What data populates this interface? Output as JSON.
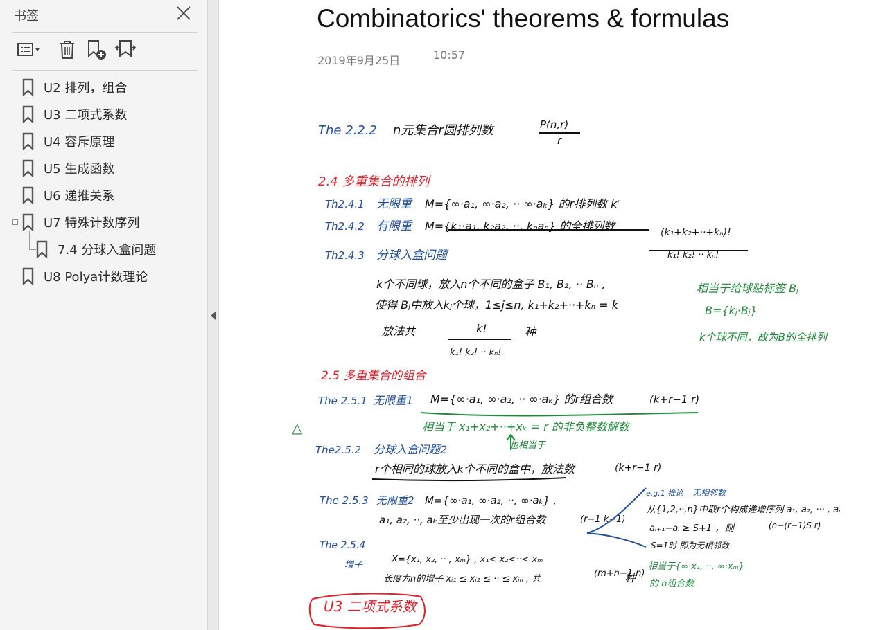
{
  "sidebar": {
    "title": "书签",
    "toolbar": {
      "options_icon": "list-options-icon",
      "delete_icon": "trash-icon",
      "add_icon": "bookmark-add-icon",
      "find_icon": "bookmark-find-icon"
    },
    "items": [
      {
        "label": "U2 排列，组合"
      },
      {
        "label": "U3 二项式系数"
      },
      {
        "label": "U4 容斥原理"
      },
      {
        "label": "U5 生成函数"
      },
      {
        "label": "U6 递推关系"
      },
      {
        "label": "U7 特殊计数序列"
      },
      {
        "label": "7.4 分球入盒问题"
      },
      {
        "label": "U8 Polya计数理论"
      }
    ]
  },
  "document": {
    "title": "Combinatorics' theorems & formulas",
    "date": "2019年9月25日",
    "time": "10:57"
  },
  "notes": {
    "colors": {
      "blue": "#1f4f9c",
      "red": "#e0202a",
      "green": "#1f8a3a",
      "dark": "#111111"
    },
    "lines": [
      {
        "text": "The 2.2.2",
        "color": "blue"
      },
      {
        "text": "n元集合r圆排列数",
        "color": "dark"
      },
      {
        "text": "P(n,r)",
        "color": "dark"
      },
      {
        "text": "r",
        "color": "dark"
      },
      {
        "text": "2.4 多重集合的排列",
        "color": "red"
      },
      {
        "text": "Th2.4.1",
        "color": "blue"
      },
      {
        "text": "无限重",
        "color": "blue"
      },
      {
        "text": "M={∞·a₁, ∞·a₂, ·· ∞·aₖ} 的r排列数 kʳ",
        "color": "dark"
      },
      {
        "text": "Th2.4.2",
        "color": "blue"
      },
      {
        "text": "有限重",
        "color": "blue"
      },
      {
        "text": "M={k₁·a₁, k₂a₂, ··, kₙaₙ} 的全排列数",
        "color": "dark"
      },
      {
        "text": "(k₁+k₂+··+kₙ)!",
        "color": "dark"
      },
      {
        "text": "k₁! k₂! ·· kₙ!",
        "color": "dark"
      },
      {
        "text": "Th2.4.3",
        "color": "blue"
      },
      {
        "text": "分球入盒问题",
        "color": "blue"
      },
      {
        "text": "k个不同球，放入n个不同的盒子 B₁, B₂, ·· Bₙ ,",
        "color": "dark"
      },
      {
        "text": "使得 Bⱼ中放入kⱼ个球，1≤j≤n, k₁+k₂+··+kₙ = k",
        "color": "dark"
      },
      {
        "text": "放法共",
        "color": "dark"
      },
      {
        "text": "k!",
        "color": "dark"
      },
      {
        "text": "k₁! k₂! ·· kₙ!",
        "color": "dark"
      },
      {
        "text": "种",
        "color": "dark"
      },
      {
        "text": "相当于给球贴标签 Bⱼ",
        "color": "green"
      },
      {
        "text": "B={kⱼ·Bⱼ}",
        "color": "green"
      },
      {
        "text": "k个球不同，故为B的全排列",
        "color": "green"
      },
      {
        "text": "2.5 多重集合的组合",
        "color": "red"
      },
      {
        "text": "The 2.5.1",
        "color": "blue"
      },
      {
        "text": "无限重1",
        "color": "blue"
      },
      {
        "text": "M={∞·a₁, ∞·a₂, ·· ∞·aₖ} 的r组合数",
        "color": "dark"
      },
      {
        "text": "(k+r−1 r)",
        "color": "dark"
      },
      {
        "text": "相当于 x₁+x₂+··+xₖ = r 的非负整数解数",
        "color": "green"
      },
      {
        "text": "△",
        "color": "green"
      },
      {
        "text": "The2.5.2",
        "color": "blue"
      },
      {
        "text": "分球入盒问题2",
        "color": "blue"
      },
      {
        "text": "也相当于",
        "color": "green"
      },
      {
        "text": "r个相同的球放入k个不同的盒中，放法数",
        "color": "dark"
      },
      {
        "text": "(k+r−1 r)",
        "color": "dark"
      },
      {
        "text": "The 2.5.3",
        "color": "blue"
      },
      {
        "text": "无限重2",
        "color": "blue"
      },
      {
        "text": "M={∞·a₁, ∞·a₂, ··, ∞·aₖ} ,",
        "color": "dark"
      },
      {
        "text": "a₁, a₂, ··, aₖ至少出现一次的r组合数",
        "color": "dark"
      },
      {
        "text": "(r−1 k−1)",
        "color": "dark"
      },
      {
        "text": "e.g.1 推论",
        "color": "blue"
      },
      {
        "text": "无相邻数",
        "color": "blue"
      },
      {
        "text": "从{1,2,··,n}中取r个构成递增序列 a₁, a₂, ··· , aᵣ",
        "color": "dark"
      },
      {
        "text": "aᵢ₊₁−aᵢ ≥ S+1 ，",
        "color": "dark"
      },
      {
        "text": "则",
        "color": "dark"
      },
      {
        "text": "(n−(r−1)S r)",
        "color": "dark"
      },
      {
        "text": "S=1时 即为无相邻数",
        "color": "dark"
      },
      {
        "text": "The 2.5.4",
        "color": "blue"
      },
      {
        "text": "增子",
        "color": "blue"
      },
      {
        "text": "X={x₁, x₂, ·· , xₘ} ,  x₁< x₂<··< xₘ",
        "color": "dark"
      },
      {
        "text": "长度为n的增子 xᵢ₁ ≤ xᵢ₂ ≤ ·· ≤ xᵢₙ , 共",
        "color": "dark"
      },
      {
        "text": "(m+n−1 n)",
        "color": "dark"
      },
      {
        "text": "种",
        "color": "dark"
      },
      {
        "text": "相当于{∞·x₁, ··, ∞·xₘ}",
        "color": "green"
      },
      {
        "text": "的 n组合数",
        "color": "green"
      },
      {
        "text": "U3 二项式系数",
        "color": "red"
      }
    ]
  }
}
